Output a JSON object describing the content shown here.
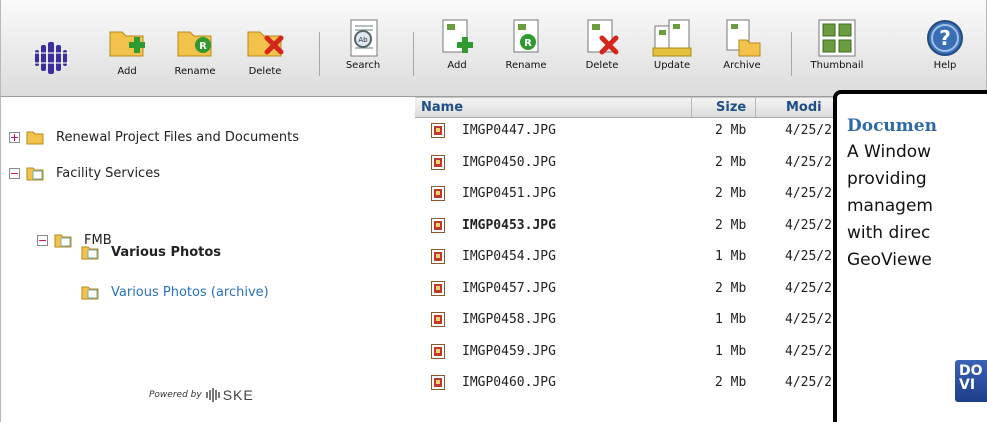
{
  "toolbar": {
    "folder_add": "Add",
    "folder_rename": "Rename",
    "folder_delete": "Delete",
    "search": "Search",
    "file_add": "Add",
    "file_rename": "Rename",
    "file_delete": "Delete",
    "update": "Update",
    "archive": "Archive",
    "thumbnail": "Thumbnail",
    "help": "Help"
  },
  "tree": {
    "nodes": [
      {
        "label": "Renewal Project Files and Documents",
        "state": "collapsed"
      },
      {
        "label": "Facility Services",
        "state": "expanded"
      },
      {
        "label": "FMB",
        "state": "expanded"
      },
      {
        "label": "Various Photos",
        "state": "selected"
      },
      {
        "label": "Various Photos (archive)",
        "state": "link"
      }
    ],
    "powered_by": "Powered by",
    "brand": "SKE"
  },
  "list": {
    "columns": {
      "name": "Name",
      "size": "Size",
      "modified": "Modi"
    },
    "rows": [
      {
        "name": "IMGP0447.JPG",
        "size": "2 Mb",
        "date": "4/25/2"
      },
      {
        "name": "IMGP0450.JPG",
        "size": "2 Mb",
        "date": "4/25/2"
      },
      {
        "name": "IMGP0451.JPG",
        "size": "2 Mb",
        "date": "4/25/2"
      },
      {
        "name": "IMGP0453.JPG",
        "size": "2 Mb",
        "date": "4/25/2"
      },
      {
        "name": "IMGP0454.JPG",
        "size": "1 Mb",
        "date": "4/25/2"
      },
      {
        "name": "IMGP0457.JPG",
        "size": "2 Mb",
        "date": "4/25/2"
      },
      {
        "name": "IMGP0458.JPG",
        "size": "1 Mb",
        "date": "4/25/2"
      },
      {
        "name": "IMGP0459.JPG",
        "size": "1 Mb",
        "date": "4/25/2"
      },
      {
        "name": "IMGP0460.JPG",
        "size": "2 Mb",
        "date": "4/25/2"
      }
    ],
    "selected_row": 3
  },
  "callout": {
    "title": "Documen",
    "lines": [
      "A Window",
      "providing",
      "managem",
      "with direc",
      "GeoViewe"
    ],
    "logo_text": "DO\nVI"
  },
  "colors": {
    "title_blue": "#2f6aa8",
    "header_text": "#1f4f86",
    "link_blue": "#2a72b8"
  }
}
